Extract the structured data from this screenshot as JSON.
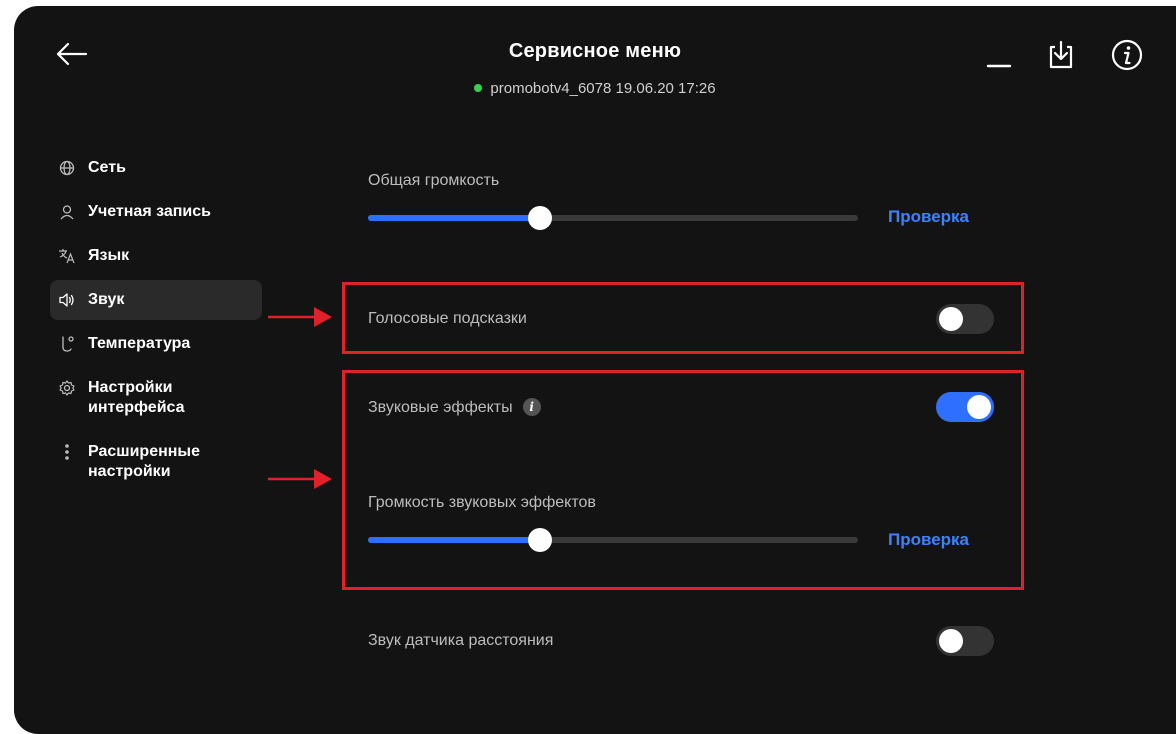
{
  "header": {
    "title": "Сервисное меню",
    "subtitle": "promobotv4_6078 19.06.20 17:26",
    "status_color": "#35d14e"
  },
  "sidebar": {
    "items": [
      {
        "label": "Сеть",
        "icon": "globe-icon",
        "active": false
      },
      {
        "label": "Учетная запись",
        "icon": "user-icon",
        "active": false
      },
      {
        "label": "Язык",
        "icon": "translate-icon",
        "active": false
      },
      {
        "label": "Звук",
        "icon": "speaker-icon",
        "active": true
      },
      {
        "label": "Температура",
        "icon": "thermometer-icon",
        "active": false
      },
      {
        "label": "Настройки\nинтерфейса",
        "icon": "gear-icon",
        "active": false
      },
      {
        "label": "Расширенные\nнастройки",
        "icon": "more-vertical-icon",
        "active": false
      }
    ]
  },
  "settings": {
    "general_volume": {
      "label": "Общая громкость",
      "level_percent": 35,
      "check_label": "Проверка"
    },
    "voice_hints": {
      "label": "Голосовые подсказки",
      "enabled": false
    },
    "sound_effects": {
      "label": "Звуковые эффекты",
      "enabled": true,
      "info_icon": "info-icon"
    },
    "effects_volume": {
      "label": "Громкость звуковых эффектов",
      "level_percent": 35,
      "check_label": "Проверка"
    },
    "distance_sensor_sound": {
      "label": "Звук датчика расстояния",
      "enabled": false
    }
  },
  "colors": {
    "accent": "#2f6fff",
    "link": "#3b82ff",
    "annotation": "#e0202a",
    "background": "#131313"
  }
}
